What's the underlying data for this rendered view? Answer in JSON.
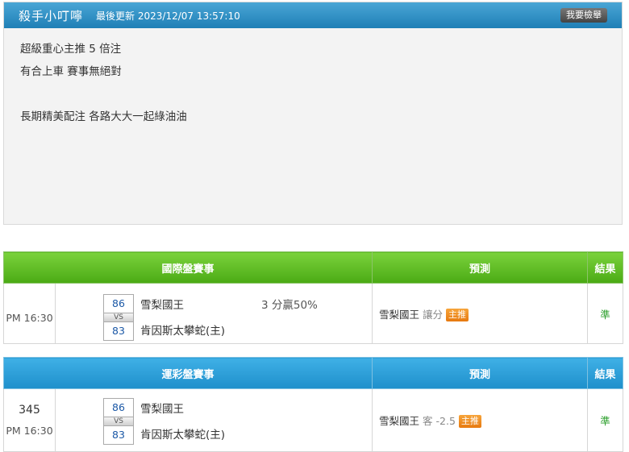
{
  "article": {
    "author": "殺手小叮嚀",
    "updated_label": "最後更新",
    "updated_time": "2023/12/07 13:57:10",
    "report_button": "我要檢舉",
    "lines": [
      "超級重心主推 5 倍注",
      "有合上車 賽事無絕對",
      "",
      "長期精美配注 各路大大一起綠油油"
    ]
  },
  "intl": {
    "header": {
      "event": "國際盤賽事",
      "prediction": "預測",
      "result": "結果"
    },
    "row": {
      "time": "PM 16:30",
      "home_score": "86",
      "vs": "VS",
      "away_score": "83",
      "home_team": "雪梨國王",
      "away_team": "肯因斯太攀蛇(主)",
      "handicap": "3 分贏50%",
      "pred_team": "雪梨國王",
      "pred_odds": "讓分",
      "badge": "主推",
      "result": "準"
    }
  },
  "sports": {
    "header": {
      "event": "運彩盤賽事",
      "prediction": "預測",
      "result": "結果"
    },
    "row": {
      "number": "345",
      "time": "PM 16:30",
      "home_score": "86",
      "vs": "VS",
      "away_score": "83",
      "home_team": "雪梨國王",
      "away_team": "肯因斯太攀蛇(主)",
      "pred_team": "雪梨國王",
      "pred_odds": "客 -2.5",
      "badge": "主推",
      "result": "準"
    }
  }
}
